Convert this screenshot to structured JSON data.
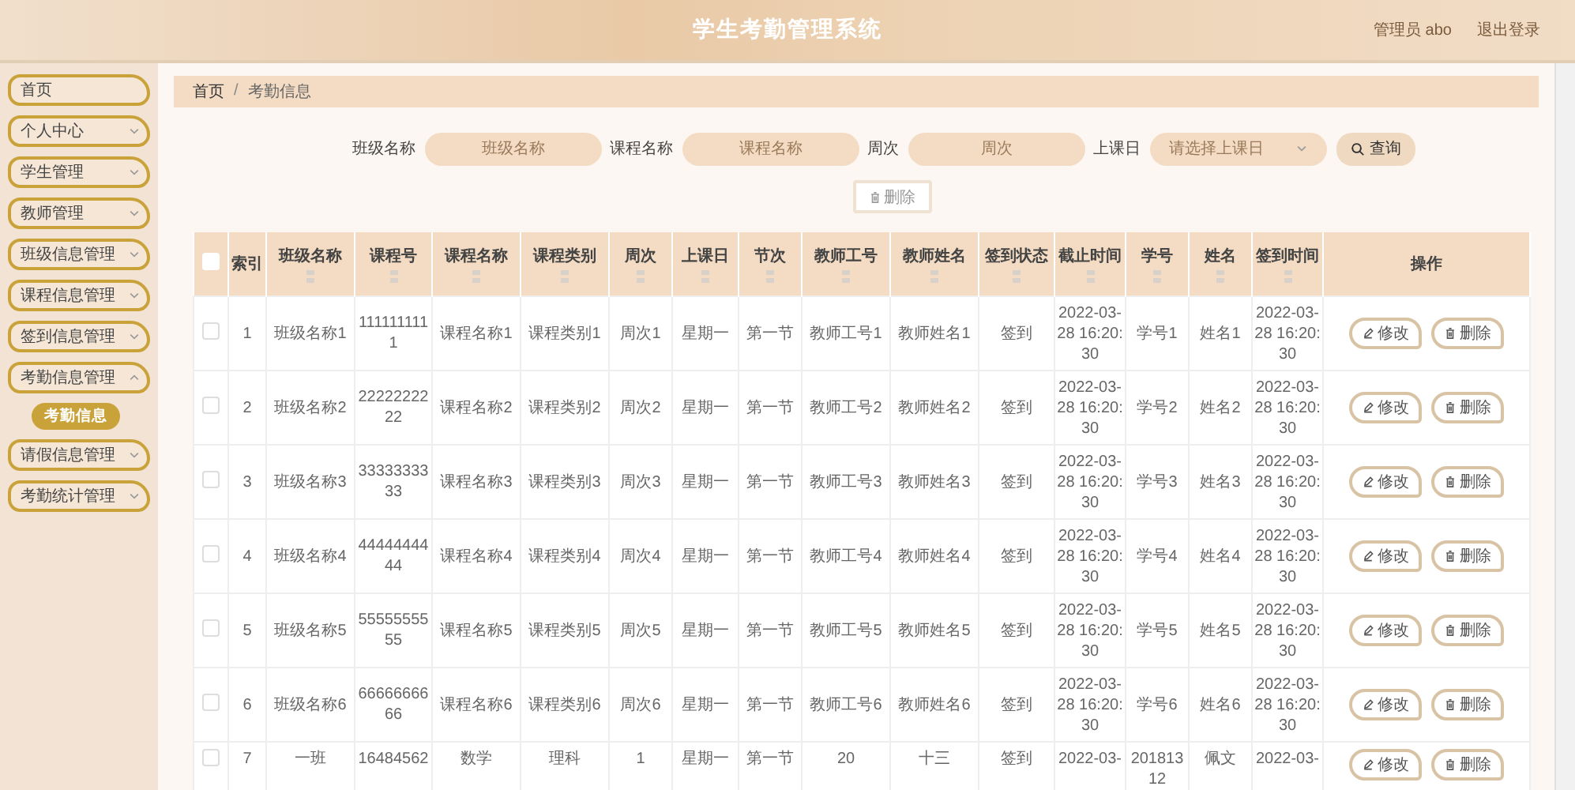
{
  "header": {
    "title": "学生考勤管理系统",
    "user": "管理员 abo",
    "logout": "退出登录"
  },
  "sidebar": {
    "items": [
      {
        "label": "首页",
        "has_children": false
      },
      {
        "label": "个人中心",
        "has_children": true,
        "expanded": false
      },
      {
        "label": "学生管理",
        "has_children": true,
        "expanded": false
      },
      {
        "label": "教师管理",
        "has_children": true,
        "expanded": false
      },
      {
        "label": "班级信息管理",
        "has_children": true,
        "expanded": false
      },
      {
        "label": "课程信息管理",
        "has_children": true,
        "expanded": false
      },
      {
        "label": "签到信息管理",
        "has_children": true,
        "expanded": false
      },
      {
        "label": "考勤信息管理",
        "has_children": true,
        "expanded": true,
        "children": [
          {
            "label": "考勤信息",
            "selected": true
          }
        ]
      },
      {
        "label": "请假信息管理",
        "has_children": true,
        "expanded": false
      },
      {
        "label": "考勤统计管理",
        "has_children": true,
        "expanded": false
      }
    ]
  },
  "breadcrumb": {
    "items": [
      "首页",
      "考勤信息"
    ],
    "separator": "/"
  },
  "filters": [
    {
      "kind": "input",
      "label": "班级名称",
      "placeholder": "班级名称"
    },
    {
      "kind": "input",
      "label": "课程名称",
      "placeholder": "课程名称"
    },
    {
      "kind": "input",
      "label": "周次",
      "placeholder": "周次"
    },
    {
      "kind": "select",
      "label": "上课日",
      "placeholder": "请选择上课日"
    }
  ],
  "search_button": "查询",
  "delete_button": {
    "label": "删除",
    "disabled": true
  },
  "table": {
    "select_all_checked": false,
    "columns": [
      {
        "label": "索引",
        "sortable": false
      },
      {
        "label": "班级名称",
        "sortable": true
      },
      {
        "label": "课程号",
        "sortable": true
      },
      {
        "label": "课程名称",
        "sortable": true
      },
      {
        "label": "课程类别",
        "sortable": true
      },
      {
        "label": "周次",
        "sortable": true
      },
      {
        "label": "上课日",
        "sortable": true
      },
      {
        "label": "节次",
        "sortable": true
      },
      {
        "label": "教师工号",
        "sortable": true
      },
      {
        "label": "教师姓名",
        "sortable": true
      },
      {
        "label": "签到状态",
        "sortable": true
      },
      {
        "label": "截止时间",
        "sortable": true
      },
      {
        "label": "学号",
        "sortable": true
      },
      {
        "label": "姓名",
        "sortable": true
      },
      {
        "label": "签到时间",
        "sortable": true
      },
      {
        "label": "操作",
        "sortable": false
      }
    ],
    "rows": [
      {
        "checked": false,
        "cells": [
          "1",
          "班级名称1",
          "1111111111",
          "课程名称1",
          "课程类别1",
          "周次1",
          "星期一",
          "第一节",
          "教师工号1",
          "教师姓名1",
          "签到",
          "2022-03-28 16:20:30",
          "学号1",
          "姓名1",
          "2022-03-28 16:20:30"
        ],
        "actions": [
          "修改",
          "删除"
        ]
      },
      {
        "checked": false,
        "cells": [
          "2",
          "班级名称2",
          "2222222222",
          "课程名称2",
          "课程类别2",
          "周次2",
          "星期一",
          "第一节",
          "教师工号2",
          "教师姓名2",
          "签到",
          "2022-03-28 16:20:30",
          "学号2",
          "姓名2",
          "2022-03-28 16:20:30"
        ],
        "actions": [
          "修改",
          "删除"
        ]
      },
      {
        "checked": false,
        "cells": [
          "3",
          "班级名称3",
          "3333333333",
          "课程名称3",
          "课程类别3",
          "周次3",
          "星期一",
          "第一节",
          "教师工号3",
          "教师姓名3",
          "签到",
          "2022-03-28 16:20:30",
          "学号3",
          "姓名3",
          "2022-03-28 16:20:30"
        ],
        "actions": [
          "修改",
          "删除"
        ]
      },
      {
        "checked": false,
        "cells": [
          "4",
          "班级名称4",
          "4444444444",
          "课程名称4",
          "课程类别4",
          "周次4",
          "星期一",
          "第一节",
          "教师工号4",
          "教师姓名4",
          "签到",
          "2022-03-28 16:20:30",
          "学号4",
          "姓名4",
          "2022-03-28 16:20:30"
        ],
        "actions": [
          "修改",
          "删除"
        ]
      },
      {
        "checked": false,
        "cells": [
          "5",
          "班级名称5",
          "5555555555",
          "课程名称5",
          "课程类别5",
          "周次5",
          "星期一",
          "第一节",
          "教师工号5",
          "教师姓名5",
          "签到",
          "2022-03-28 16:20:30",
          "学号5",
          "姓名5",
          "2022-03-28 16:20:30"
        ],
        "actions": [
          "修改",
          "删除"
        ]
      },
      {
        "checked": false,
        "cells": [
          "6",
          "班级名称6",
          "6666666666",
          "课程名称6",
          "课程类别6",
          "周次6",
          "星期一",
          "第一节",
          "教师工号6",
          "教师姓名6",
          "签到",
          "2022-03-28 16:20:30",
          "学号6",
          "姓名6",
          "2022-03-28 16:20:30"
        ],
        "actions": [
          "修改",
          "删除"
        ]
      },
      {
        "checked": false,
        "cells": [
          "7",
          "一班",
          "16484562",
          "数学",
          "理科",
          "1",
          "星期一",
          "第一节",
          "20",
          "十三",
          "签到",
          "2022-03-",
          "20181312",
          "佩文",
          "2022-03-"
        ],
        "actions": [
          "修改",
          "删除"
        ]
      }
    ]
  }
}
